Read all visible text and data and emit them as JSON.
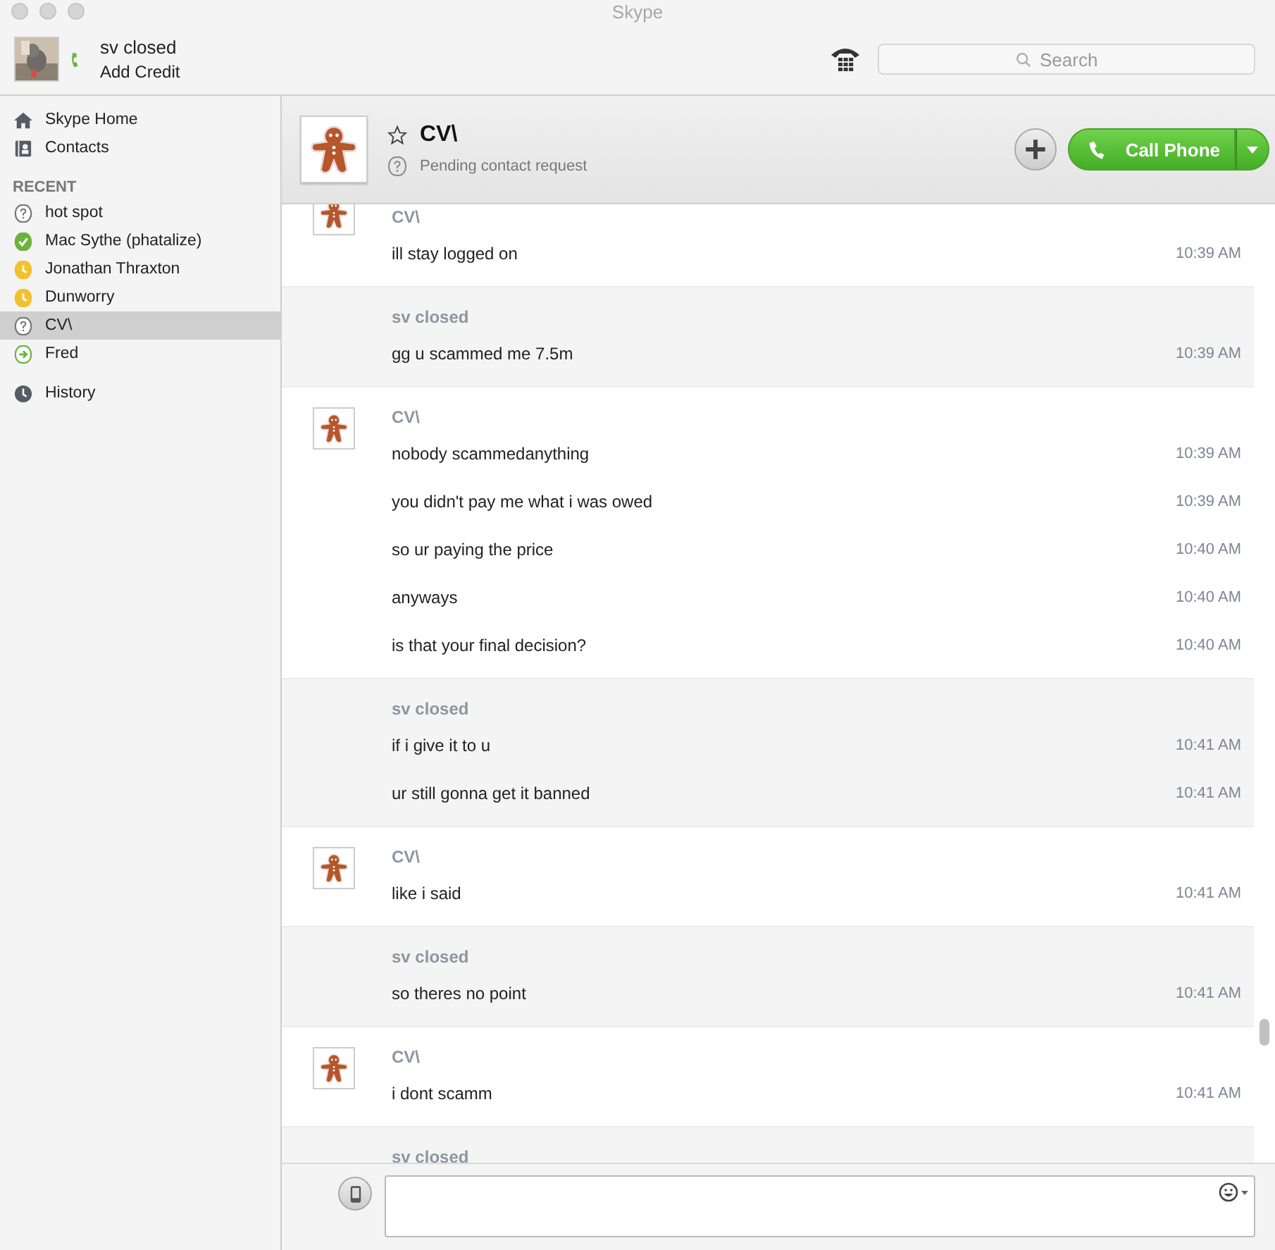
{
  "window": {
    "title": "Skype"
  },
  "account": {
    "name": "sv closed",
    "credit_link": "Add Credit"
  },
  "search": {
    "placeholder": "Search"
  },
  "sidebar": {
    "items": [
      {
        "label": "Skype Home",
        "kind": "home",
        "selected": false
      },
      {
        "label": "Contacts",
        "kind": "contacts",
        "selected": false
      }
    ],
    "recent_heading": "RECENT",
    "recent": [
      {
        "label": "hot spot",
        "kind": "unknown",
        "selected": false
      },
      {
        "label": "Mac Sythe (phatalize)",
        "kind": "online",
        "selected": false
      },
      {
        "label": "Jonathan Thraxton",
        "kind": "away",
        "selected": false
      },
      {
        "label": "Dunworry",
        "kind": "away",
        "selected": false
      },
      {
        "label": "CV\\",
        "kind": "unknown",
        "selected": true
      },
      {
        "label": "Fred",
        "kind": "forwarding",
        "selected": false
      }
    ],
    "history": {
      "label": "History",
      "selected": false
    }
  },
  "chat_header": {
    "name": "CV\\",
    "favorite": false,
    "status_text": "Pending contact request",
    "call_button": "Call Phone"
  },
  "messages": [
    {
      "sender": "CV\\",
      "kind": "them",
      "lines": [
        {
          "text": "ill stay logged on",
          "time": "10:39 AM"
        }
      ]
    },
    {
      "sender": "sv closed",
      "kind": "me",
      "lines": [
        {
          "text": "gg u scammed me 7.5m",
          "time": "10:39 AM"
        }
      ]
    },
    {
      "sender": "CV\\",
      "kind": "them",
      "lines": [
        {
          "text": "nobody scammedanything",
          "time": "10:39 AM"
        },
        {
          "text": "you didn't pay me what i was owed",
          "time": "10:39 AM"
        },
        {
          "text": "so ur paying the price",
          "time": "10:40 AM"
        },
        {
          "text": "anyways",
          "time": "10:40 AM"
        },
        {
          "text": "is that your final decision?",
          "time": "10:40 AM"
        }
      ]
    },
    {
      "sender": "sv closed",
      "kind": "me",
      "lines": [
        {
          "text": "if i give it to u",
          "time": "10:41 AM"
        },
        {
          "text": "ur still gonna get it banned",
          "time": "10:41 AM"
        }
      ]
    },
    {
      "sender": "CV\\",
      "kind": "them",
      "lines": [
        {
          "text": "like i said",
          "time": "10:41 AM"
        }
      ]
    },
    {
      "sender": "sv closed",
      "kind": "me",
      "lines": [
        {
          "text": "so theres no point",
          "time": "10:41 AM"
        }
      ]
    },
    {
      "sender": "CV\\",
      "kind": "them",
      "lines": [
        {
          "text": "i dont scamm",
          "time": "10:41 AM"
        }
      ]
    },
    {
      "sender": "sv closed",
      "kind": "me"
    }
  ]
}
